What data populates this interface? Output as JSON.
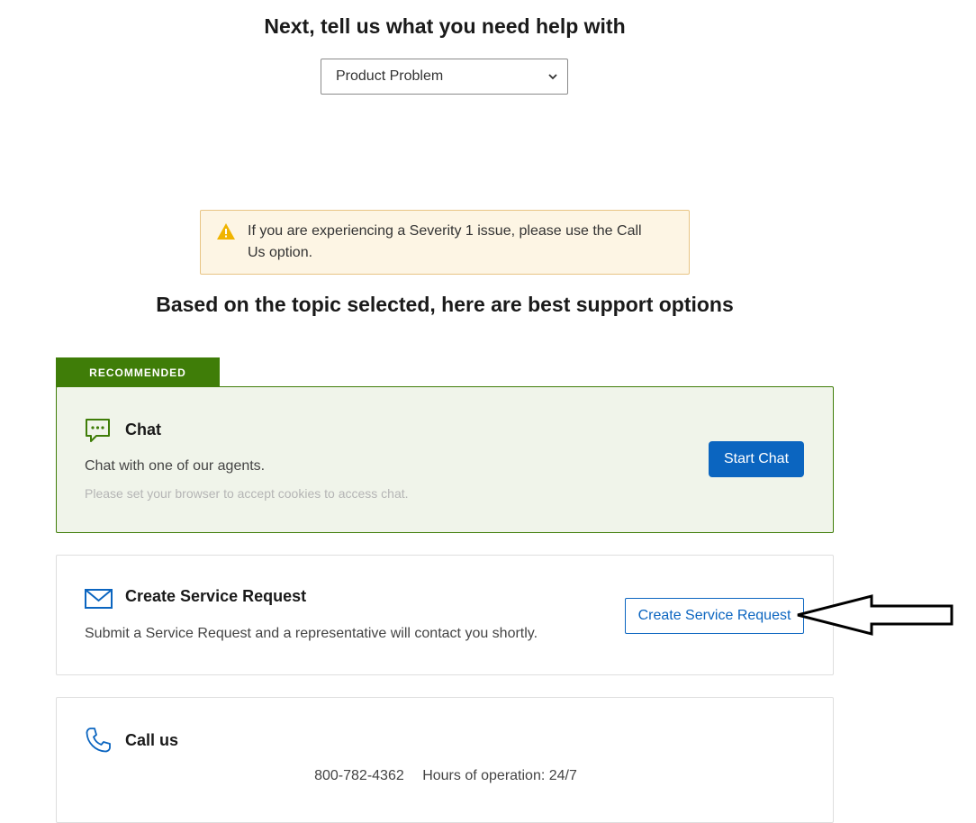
{
  "heading": "Next, tell us what you need help with",
  "topic_select": {
    "selected": "Product Problem"
  },
  "alert": {
    "message": "If you are experiencing a Severity 1 issue, please use the Call Us option."
  },
  "options_heading": "Based on the topic selected, here are best support options",
  "recommended_label": "RECOMMENDED",
  "chat": {
    "title": "Chat",
    "description": "Chat with one of our agents.",
    "cookie_note": "Please set your browser to accept cookies to access chat.",
    "button": "Start Chat",
    "icon": "chat-bubble-icon"
  },
  "service_request": {
    "title": "Create Service Request",
    "description": "Submit a Service Request and a representative will contact you shortly.",
    "button": "Create Service Request",
    "icon": "envelope-icon"
  },
  "call": {
    "title": "Call us",
    "phone": "800-782-4362",
    "hours": "Hours of operation: 24/7",
    "icon": "phone-icon"
  },
  "colors": {
    "brand_blue": "#0b65c0",
    "recommended_green": "#3f7d08",
    "alert_bg": "#fdf5e4",
    "warning_yellow": "#f0b400"
  }
}
